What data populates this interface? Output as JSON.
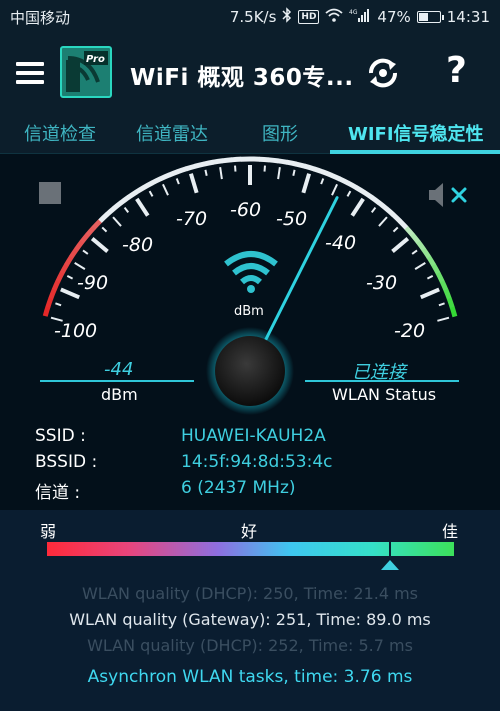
{
  "statusbar": {
    "carrier": "中国移动",
    "speed": "7.5K/s",
    "hd": "HD",
    "network": "4G",
    "battery": "47%",
    "battery_level": 0.47,
    "time": "14:31"
  },
  "appbar": {
    "title": "WiFi 概观 360专...",
    "logo_badge": "Pro"
  },
  "tabs": [
    {
      "label": "信道检查"
    },
    {
      "label": "信道雷达"
    },
    {
      "label": "图形"
    },
    {
      "label": "WIFI信号稳定性"
    }
  ],
  "gauge": {
    "tick_labels": [
      "-100",
      "-90",
      "-80",
      "-70",
      "-60",
      "-50",
      "-40",
      "-30",
      "-20"
    ],
    "center_unit": "dBm",
    "signal_value": "-44",
    "signal_unit": "dBm",
    "status_value": "已连接",
    "status_label": "WLAN Status",
    "needle_dbm": -44
  },
  "info": {
    "ssid_label": "SSID :",
    "ssid_value": "HUAWEI-KAUH2A",
    "bssid_label": "BSSID :",
    "bssid_value": "14:5f:94:8d:53:4c",
    "channel_label": "信道 :",
    "channel_value": "6 (2437 MHz)"
  },
  "quality": {
    "weak": "弱",
    "good": "好",
    "best": "佳",
    "level": 0.84
  },
  "log": {
    "line1": "WLAN quality (DHCP): 250, Time: 21.4 ms",
    "line2": "WLAN quality (Gateway): 251, Time: 89.0 ms",
    "line3": "WLAN quality (DHCP): 252, Time: 5.7 ms",
    "async": "Asynchron WLAN tasks, time: 3.76 ms"
  }
}
